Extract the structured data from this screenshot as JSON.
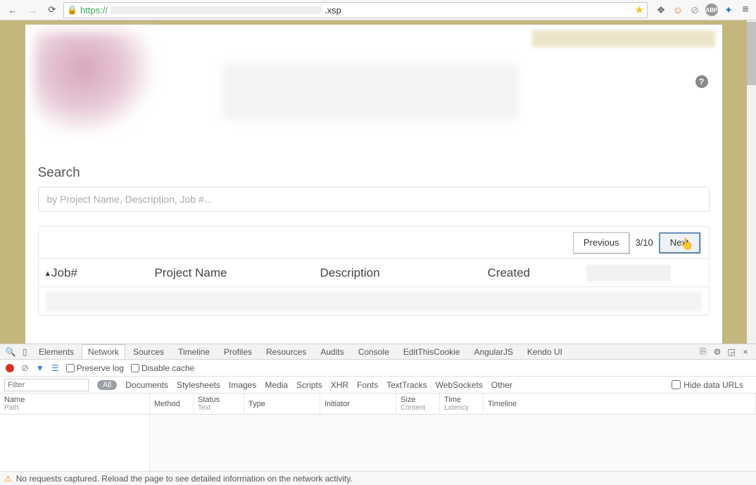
{
  "browser": {
    "protocol": "https://",
    "url_suffix": ".xsp"
  },
  "page": {
    "help_icon": "?",
    "search_label": "Search",
    "search_placeholder": "by Project Name, Description, Job #...",
    "pager": {
      "prev": "Previous",
      "indicator": "3/10",
      "next": "Next"
    },
    "columns": {
      "job": "Job#",
      "project_name": "Project Name",
      "description": "Description",
      "created": "Created"
    }
  },
  "devtools": {
    "tabs": [
      "Elements",
      "Network",
      "Sources",
      "Timeline",
      "Profiles",
      "Resources",
      "Audits",
      "Console",
      "EditThisCookie",
      "AngularJS",
      "Kendo UI"
    ],
    "active_tab": "Network",
    "preserve_log": "Preserve log",
    "disable_cache": "Disable cache",
    "filter_placeholder": "Filter",
    "all_pill": "All",
    "categories": [
      "Documents",
      "Stylesheets",
      "Images",
      "Media",
      "Scripts",
      "XHR",
      "Fonts",
      "TextTracks",
      "WebSockets",
      "Other"
    ],
    "hide_data_urls": "Hide data URLs",
    "cols": {
      "name": "Name",
      "name_sub": "Path",
      "method": "Method",
      "status": "Status",
      "status_sub": "Text",
      "type": "Type",
      "initiator": "Initiator",
      "size": "Size",
      "size_sub": "Content",
      "time": "Time",
      "time_sub": "Latency",
      "timeline": "Timeline"
    },
    "status_msg": "No requests captured. Reload the page to see detailed information on the network activity."
  }
}
